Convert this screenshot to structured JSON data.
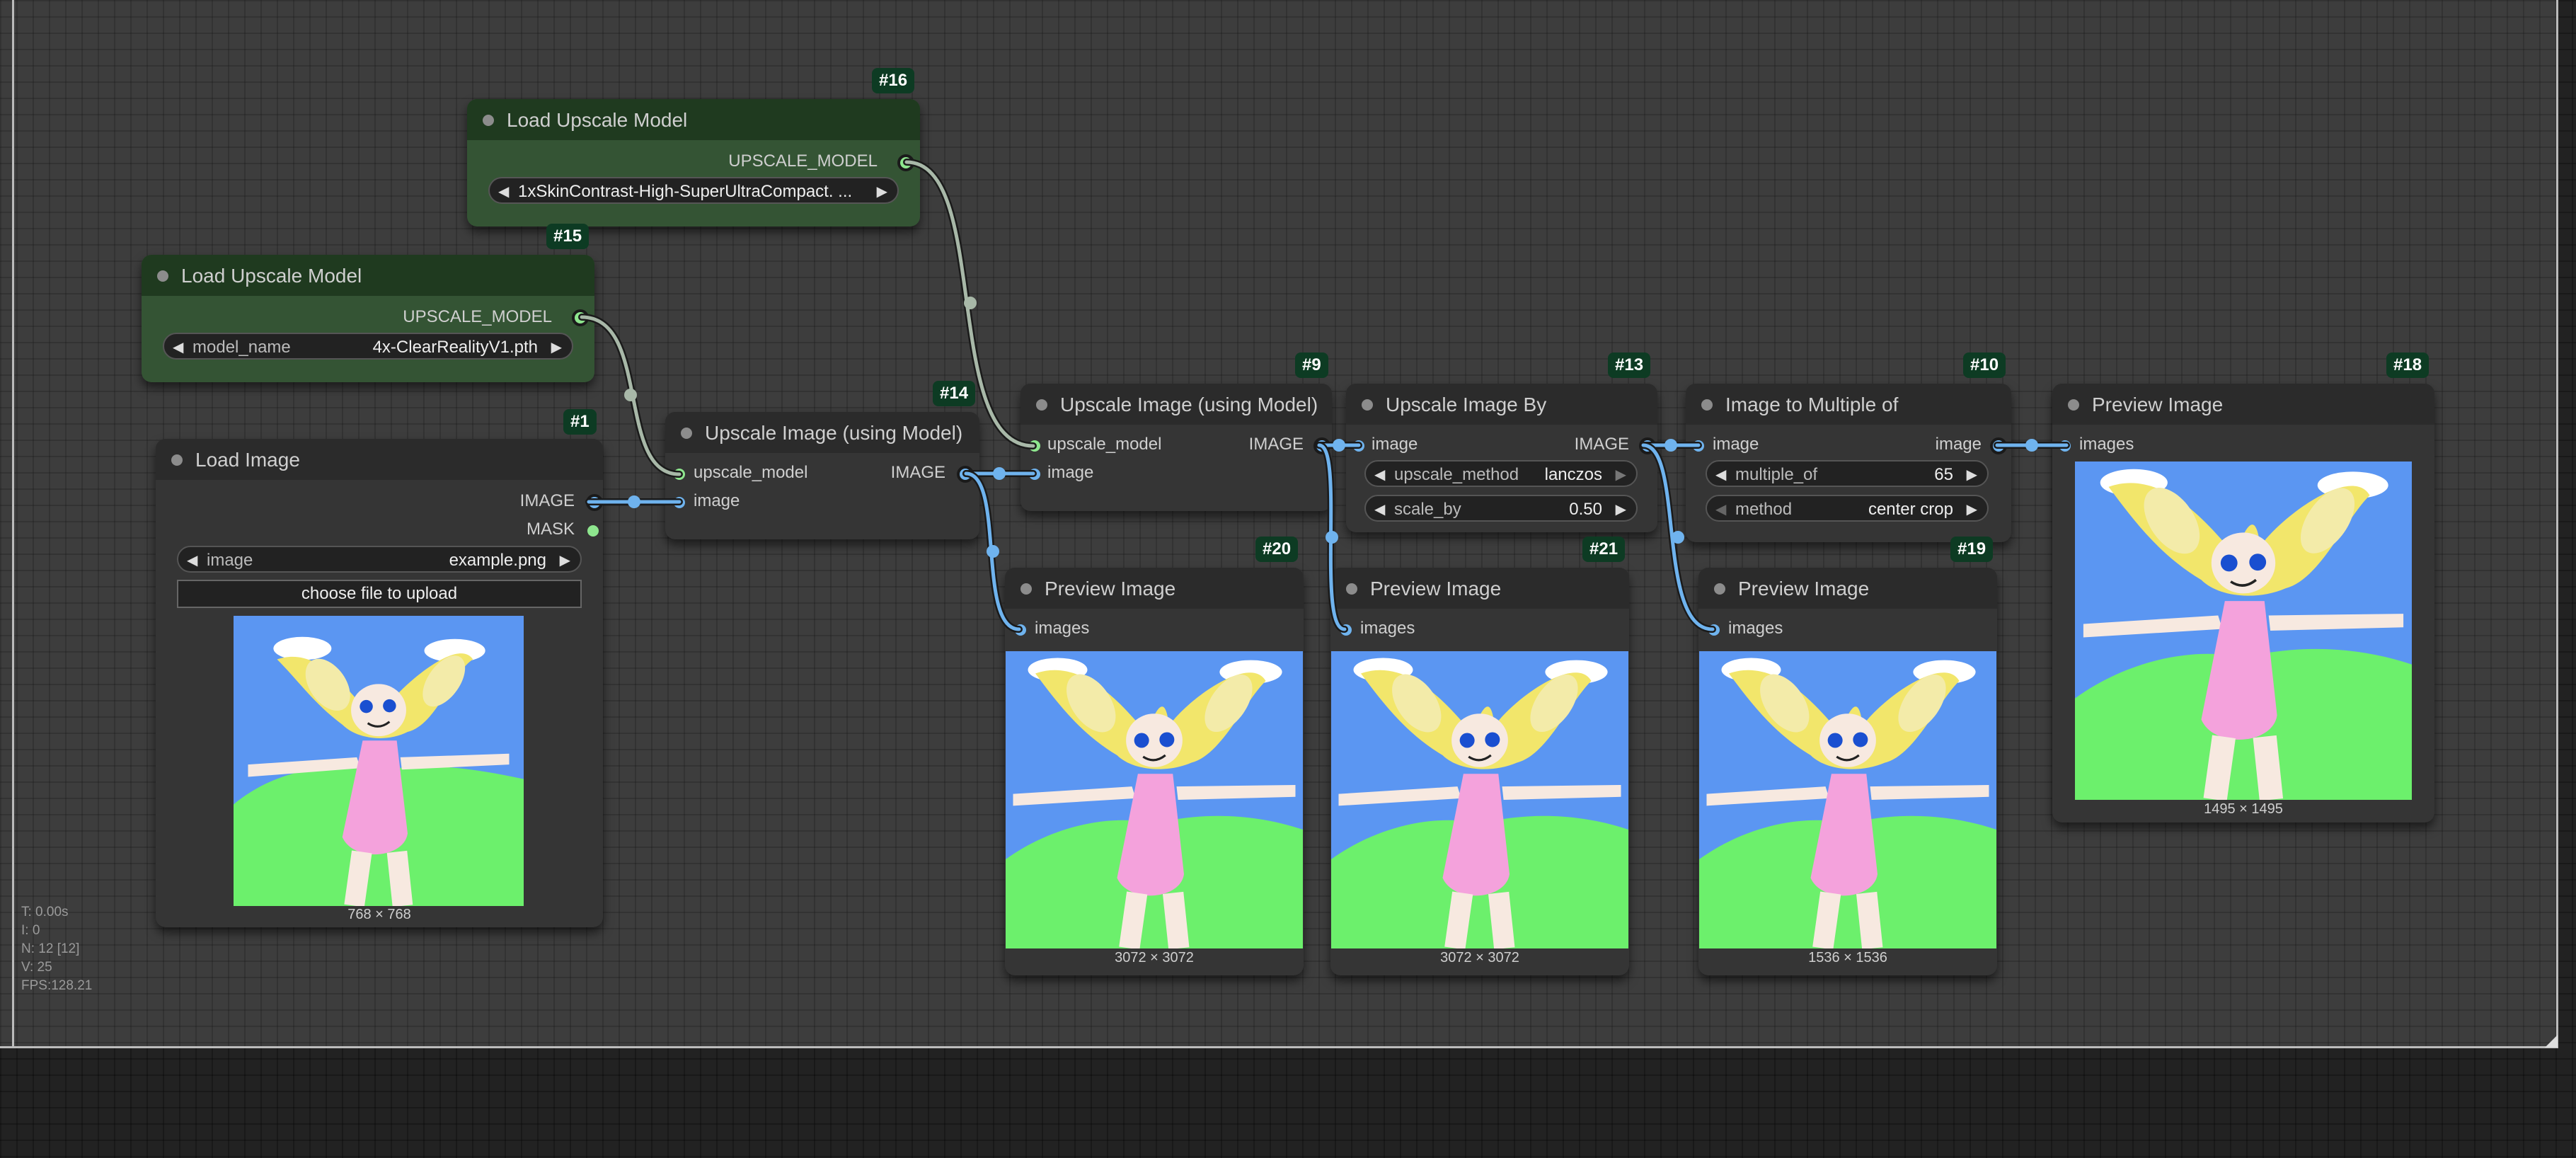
{
  "nodes": {
    "load_upscale_16": {
      "id": "#16",
      "title": "Load Upscale Model",
      "output": "UPSCALE_MODEL",
      "widget": {
        "value": "1xSkinContrast-High-SuperUltraCompact. ..."
      }
    },
    "load_upscale_15": {
      "id": "#15",
      "title": "Load Upscale Model",
      "output": "UPSCALE_MODEL",
      "widget": {
        "label": "model_name",
        "value": "4x-ClearRealityV1.pth"
      }
    },
    "load_image_1": {
      "id": "#1",
      "title": "Load Image",
      "outputs": [
        "IMAGE",
        "MASK"
      ],
      "widget": {
        "label": "image",
        "value": "example.png"
      },
      "button": "choose file to upload",
      "image_size": "768 × 768"
    },
    "upscale_14": {
      "id": "#14",
      "title": "Upscale Image (using Model)",
      "inputs": [
        "upscale_model",
        "image"
      ],
      "output": "IMAGE"
    },
    "upscale_9": {
      "id": "#9",
      "title": "Upscale Image (using Model)",
      "inputs": [
        "upscale_model",
        "image"
      ],
      "output": "IMAGE"
    },
    "upscale_by_13": {
      "id": "#13",
      "title": "Upscale Image By",
      "input": "image",
      "output": "IMAGE",
      "widgets": [
        {
          "label": "upscale_method",
          "value": "lanczos"
        },
        {
          "label": "scale_by",
          "value": "0.50"
        }
      ]
    },
    "multiple_10": {
      "id": "#10",
      "title": "Image to Multiple of",
      "input": "image",
      "output": "image",
      "widgets": [
        {
          "label": "multiple_of",
          "value": "65"
        },
        {
          "label": "method",
          "value": "center crop"
        }
      ]
    },
    "preview_18": {
      "id": "#18",
      "title": "Preview Image",
      "input": "images",
      "image_size": "1495 × 1495"
    },
    "preview_20": {
      "id": "#20",
      "title": "Preview Image",
      "input": "images",
      "image_size": "3072 × 3072"
    },
    "preview_21": {
      "id": "#21",
      "title": "Preview Image",
      "input": "images",
      "image_size": "3072 × 3072"
    },
    "preview_19": {
      "id": "#19",
      "title": "Preview Image",
      "input": "images",
      "image_size": "1536 × 1536"
    }
  },
  "stats": {
    "t": "T: 0.00s",
    "i": "I: 0",
    "n": "N: 12 [12]",
    "v": "V: 25",
    "fps": "FPS:128.21"
  },
  "colors": {
    "canvas": "#3d3d3d",
    "node": "#353535",
    "node_green": "#345434",
    "link_image": "#6fb3ee",
    "link_model": "#a8b8a8",
    "node_id_badge": "#0d3b23"
  },
  "icons": [
    "arrow-left-icon",
    "arrow-right-icon",
    "node-collapse-dot-icon"
  ]
}
